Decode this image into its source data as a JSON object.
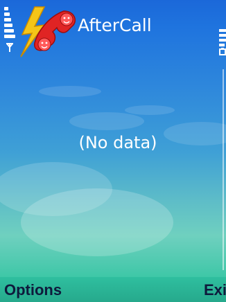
{
  "app": {
    "title": "AfterCall",
    "logo_icon": "phone-lightning-logo"
  },
  "status": {
    "signal_icon": "signal-strength-icon",
    "battery_icon": "battery-icon"
  },
  "main": {
    "message": "(No data)"
  },
  "softkeys": {
    "left_label": "Options",
    "right_label": "Exit"
  },
  "colors": {
    "background_top": "#1b68d9",
    "background_bottom": "#3ec7a7",
    "softkey_text": "#0e1a3c",
    "logo_red": "#e02424",
    "logo_yellow": "#f5c518"
  }
}
